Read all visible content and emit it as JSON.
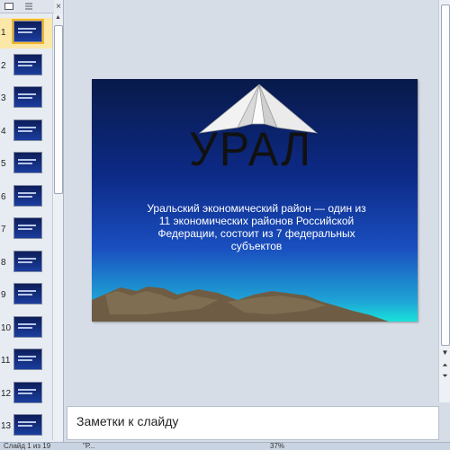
{
  "slide_panel": {
    "tab_icons": [
      "slides-tab-icon",
      "outline-tab-icon"
    ],
    "close_icon": "close-icon",
    "thumbnails": [
      {
        "num": "1",
        "active": true
      },
      {
        "num": "2"
      },
      {
        "num": "3"
      },
      {
        "num": "4"
      },
      {
        "num": "5"
      },
      {
        "num": "6"
      },
      {
        "num": "7"
      },
      {
        "num": "8"
      },
      {
        "num": "9"
      },
      {
        "num": "10"
      },
      {
        "num": "11"
      },
      {
        "num": "12"
      },
      {
        "num": "13"
      }
    ]
  },
  "slide": {
    "title": "УРАЛ",
    "subtitle": "Уральский экономический район — один из 11 экономических районов Российской Федерации, состоит из 7 федеральных субъектов",
    "colors": {
      "background_top": "#081a4a",
      "background_bottom": "#19e1db",
      "mountains": "#6e5d44"
    }
  },
  "notes": {
    "placeholder": "Заметки к слайду"
  },
  "status_bar": {
    "slide_counter": "Слайд 1 из 19",
    "theme": "\"Р...",
    "zoom": "37%"
  }
}
